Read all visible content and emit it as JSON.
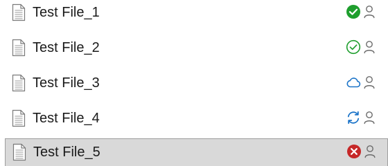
{
  "files": [
    {
      "name": "Test File_1",
      "status_icon": "synced-check-filled-icon",
      "status_color": "#1e9e2d",
      "selected": false
    },
    {
      "name": "Test File_2",
      "status_icon": "available-check-outline-icon",
      "status_color": "#1e9e2d",
      "selected": false
    },
    {
      "name": "Test File_3",
      "status_icon": "cloud-only-icon",
      "status_color": "#1a73c8",
      "selected": false
    },
    {
      "name": "Test File_4",
      "status_icon": "syncing-arrows-icon",
      "status_color": "#1a73c8",
      "selected": false
    },
    {
      "name": "Test File_5",
      "status_icon": "sync-error-icon",
      "status_color": "#c62828",
      "selected": true
    }
  ],
  "colors": {
    "selection_background": "#d9d9d9",
    "selection_border": "#9e9e9e",
    "person_icon": "#6b6b6b",
    "file_icon": "#7a7a7a"
  },
  "person_icon": "shared-person-icon",
  "file_icon": "document-icon"
}
